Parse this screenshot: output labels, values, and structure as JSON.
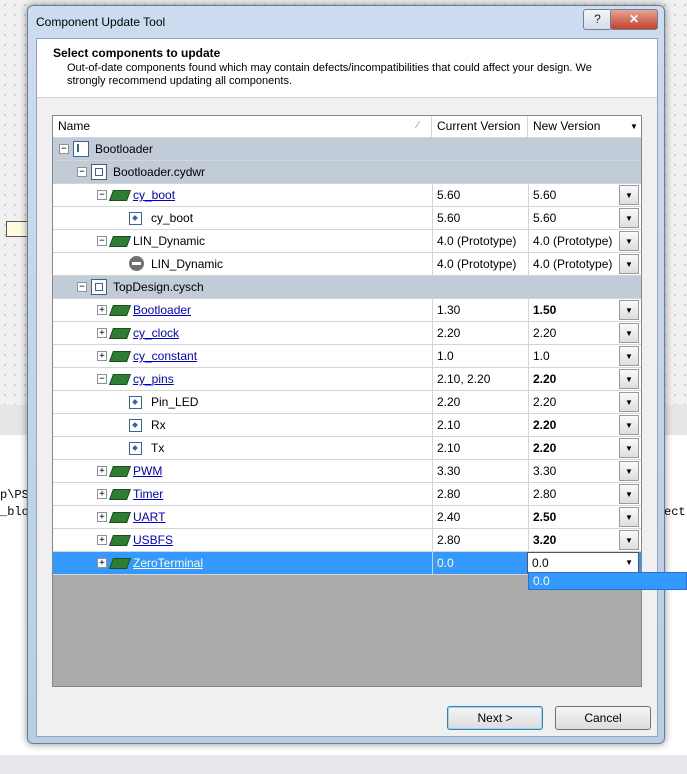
{
  "window": {
    "title": "Component Update Tool",
    "help_label": "?",
    "close_label": "✕"
  },
  "header": {
    "title": "Select components to update",
    "description": "Out-of-date components found which may contain defects/incompatibilities that could affect your design. We strongly recommend updating all components."
  },
  "columns": {
    "name": "Name",
    "current": "Current Version",
    "new": "New Version"
  },
  "rows": [
    {
      "name": "Bootloader",
      "icon": "project-icon",
      "group": true
    },
    {
      "name": "Bootloader.cydwr",
      "icon": "schematic-icon",
      "group": true
    },
    {
      "name": "cy_boot",
      "icon": "component-icon",
      "link": true,
      "current": "5.60",
      "new": "5.60",
      "new_bold": false
    },
    {
      "name": "cy_boot",
      "icon": "instance-icon",
      "current": "5.60",
      "new": "5.60",
      "new_bold": false
    },
    {
      "name": "LIN_Dynamic",
      "icon": "component-icon",
      "current": "4.0 (Prototype)",
      "new": "4.0 (Prototype)",
      "new_bold": false
    },
    {
      "name": "LIN_Dynamic",
      "icon": "blocked-icon",
      "current": "4.0 (Prototype)",
      "new": "4.0 (Prototype)",
      "new_bold": false
    },
    {
      "name": "TopDesign.cysch",
      "icon": "schematic-icon",
      "group": true
    },
    {
      "name": "Bootloader",
      "icon": "component-icon",
      "link": true,
      "current": "1.30",
      "new": "1.50",
      "new_bold": true
    },
    {
      "name": "cy_clock",
      "icon": "component-icon",
      "link": true,
      "current": "2.20",
      "new": "2.20",
      "new_bold": false
    },
    {
      "name": "cy_constant",
      "icon": "component-icon",
      "link": true,
      "current": "1.0",
      "new": "1.0",
      "new_bold": false
    },
    {
      "name": "cy_pins",
      "icon": "component-icon",
      "link": true,
      "current": "2.10, 2.20",
      "new": "2.20",
      "new_bold": true
    },
    {
      "name": "Pin_LED",
      "icon": "instance-icon",
      "current": "2.20",
      "new": "2.20",
      "new_bold": false
    },
    {
      "name": "Rx",
      "icon": "instance-icon",
      "current": "2.10",
      "new": "2.20",
      "new_bold": true
    },
    {
      "name": "Tx",
      "icon": "instance-icon",
      "current": "2.10",
      "new": "2.20",
      "new_bold": true
    },
    {
      "name": "PWM",
      "icon": "component-icon",
      "link": true,
      "current": "3.30",
      "new": "3.30",
      "new_bold": false
    },
    {
      "name": "Timer",
      "icon": "component-icon",
      "link": true,
      "current": "2.80",
      "new": "2.80",
      "new_bold": false
    },
    {
      "name": "UART",
      "icon": "component-icon",
      "link": true,
      "current": "2.40",
      "new": "2.50",
      "new_bold": true
    },
    {
      "name": "USBFS",
      "icon": "component-icon",
      "link": true,
      "current": "2.80",
      "new": "3.20",
      "new_bold": true
    },
    {
      "name": "ZeroTerminal",
      "icon": "component-icon",
      "link": true,
      "current": "0.0",
      "new": "0.0",
      "new_bold": false,
      "selected": true
    }
  ],
  "dropdown_open": {
    "option": "0.0"
  },
  "buttons": {
    "next": "Next >",
    "cancel": "Cancel"
  },
  "background": {
    "line1": "p\\PS",
    "line2": "_blo",
    "line3": "ect"
  }
}
